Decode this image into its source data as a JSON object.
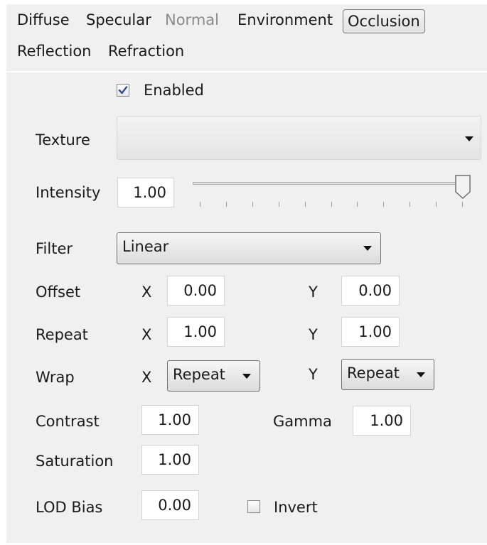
{
  "tabs": {
    "row1": [
      {
        "label": "Diffuse",
        "state": "normal"
      },
      {
        "label": "Specular",
        "state": "normal"
      },
      {
        "label": "Normal",
        "state": "disabled"
      },
      {
        "label": "Environment",
        "state": "normal"
      },
      {
        "label": "Occlusion",
        "state": "active"
      }
    ],
    "row2": [
      {
        "label": "Reflection",
        "state": "normal"
      },
      {
        "label": "Refraction",
        "state": "normal"
      }
    ]
  },
  "enabled": {
    "label": "Enabled",
    "checked": true
  },
  "texture": {
    "label": "Texture",
    "value": ""
  },
  "intensity": {
    "label": "Intensity",
    "value": "1.00",
    "slider_fraction": 1.0
  },
  "filter": {
    "label": "Filter",
    "value": "Linear"
  },
  "offset": {
    "label": "Offset",
    "x_label": "X",
    "x": "0.00",
    "y_label": "Y",
    "y": "0.00"
  },
  "repeat": {
    "label": "Repeat",
    "x_label": "X",
    "x": "1.00",
    "y_label": "Y",
    "y": "1.00"
  },
  "wrap": {
    "label": "Wrap",
    "x_label": "X",
    "x": "Repeat",
    "y_label": "Y",
    "y": "Repeat"
  },
  "contrast": {
    "label": "Contrast",
    "value": "1.00"
  },
  "gamma": {
    "label": "Gamma",
    "value": "1.00"
  },
  "saturation": {
    "label": "Saturation",
    "value": "1.00"
  },
  "lod_bias": {
    "label": "LOD Bias",
    "value": "0.00"
  },
  "invert": {
    "label": "Invert",
    "checked": false
  },
  "colors": {
    "panel": "#f0f0f0",
    "check_mark": "#2b4f9e"
  }
}
